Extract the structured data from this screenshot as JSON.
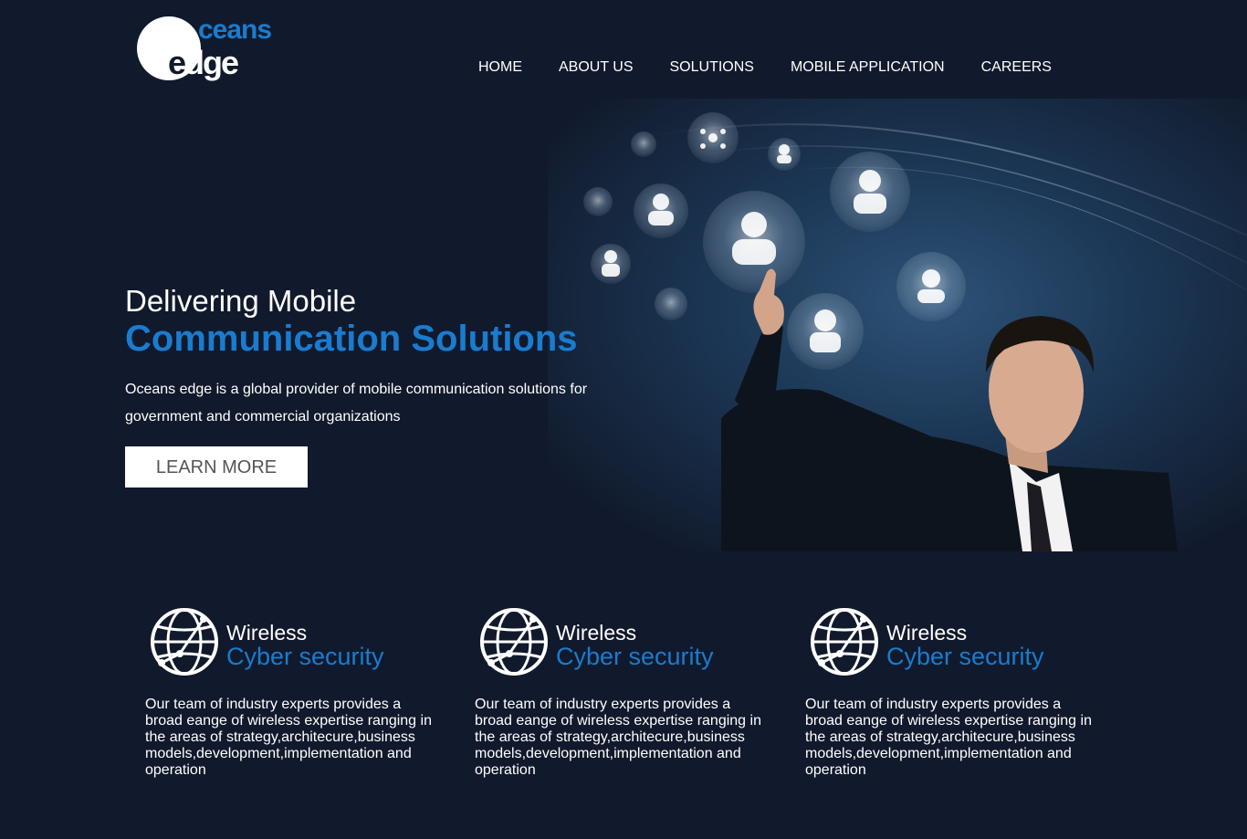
{
  "brand": {
    "logo_top": "ceans",
    "logo_bottom_e": "e",
    "logo_bottom_rest": "dge"
  },
  "nav": {
    "items": [
      {
        "label": "HOME"
      },
      {
        "label": "ABOUT US"
      },
      {
        "label": "SOLUTIONS"
      },
      {
        "label": "MOBILE APPLICATION"
      },
      {
        "label": "CAREERS"
      }
    ]
  },
  "hero": {
    "title_line1": "Delivering Mobile",
    "title_line2": "Communication Solutions",
    "description": "Oceans edge is a global provider of mobile communication solutions for government and commercial organizations",
    "button_label": "LEARN MORE"
  },
  "features": [
    {
      "title_line1": "Wireless",
      "title_line2": "Cyber security",
      "description": "Our team of industry experts provides a broad eange of wireless expertise ranging in the areas of strategy,architecure,business models,development,implementation and operation",
      "icon": "globe-network-icon"
    },
    {
      "title_line1": "Wireless",
      "title_line2": "Cyber security",
      "description": "Our team of industry experts provides a broad eange of wireless expertise ranging in the areas of strategy,architecure,business models,development,implementation and operation",
      "icon": "globe-network-icon"
    },
    {
      "title_line1": "Wireless",
      "title_line2": "Cyber security",
      "description": "Our team of industry experts provides a broad eange of wireless expertise ranging in the areas of strategy,architecure,business models,development,implementation and operation",
      "icon": "globe-network-icon"
    }
  ],
  "colors": {
    "background": "#111a2c",
    "accent": "#1a7ccf",
    "text": "#ffffff"
  }
}
